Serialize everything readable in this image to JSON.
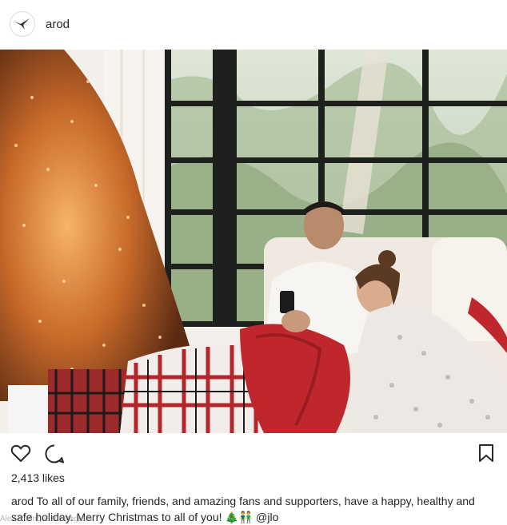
{
  "post": {
    "username": "arod",
    "likes": "2,413 likes",
    "caption_user": "arod",
    "caption_text": "To all of our family, friends, and amazing fans and supporters, have a happy, healthy and safe holiday. Merry Christmas to all of you!",
    "caption_emoji": "🎄👬",
    "caption_mention": "@jlo",
    "watermark": "Alex Rodriguez/Instagram"
  },
  "icons": {
    "avatar": "arod-logo-icon",
    "like": "heart-icon",
    "comment": "comment-bubble-icon",
    "save": "bookmark-icon"
  },
  "colors": {
    "text": "#262626",
    "border": "#dbdbdb",
    "blanket": "#c0272d"
  }
}
